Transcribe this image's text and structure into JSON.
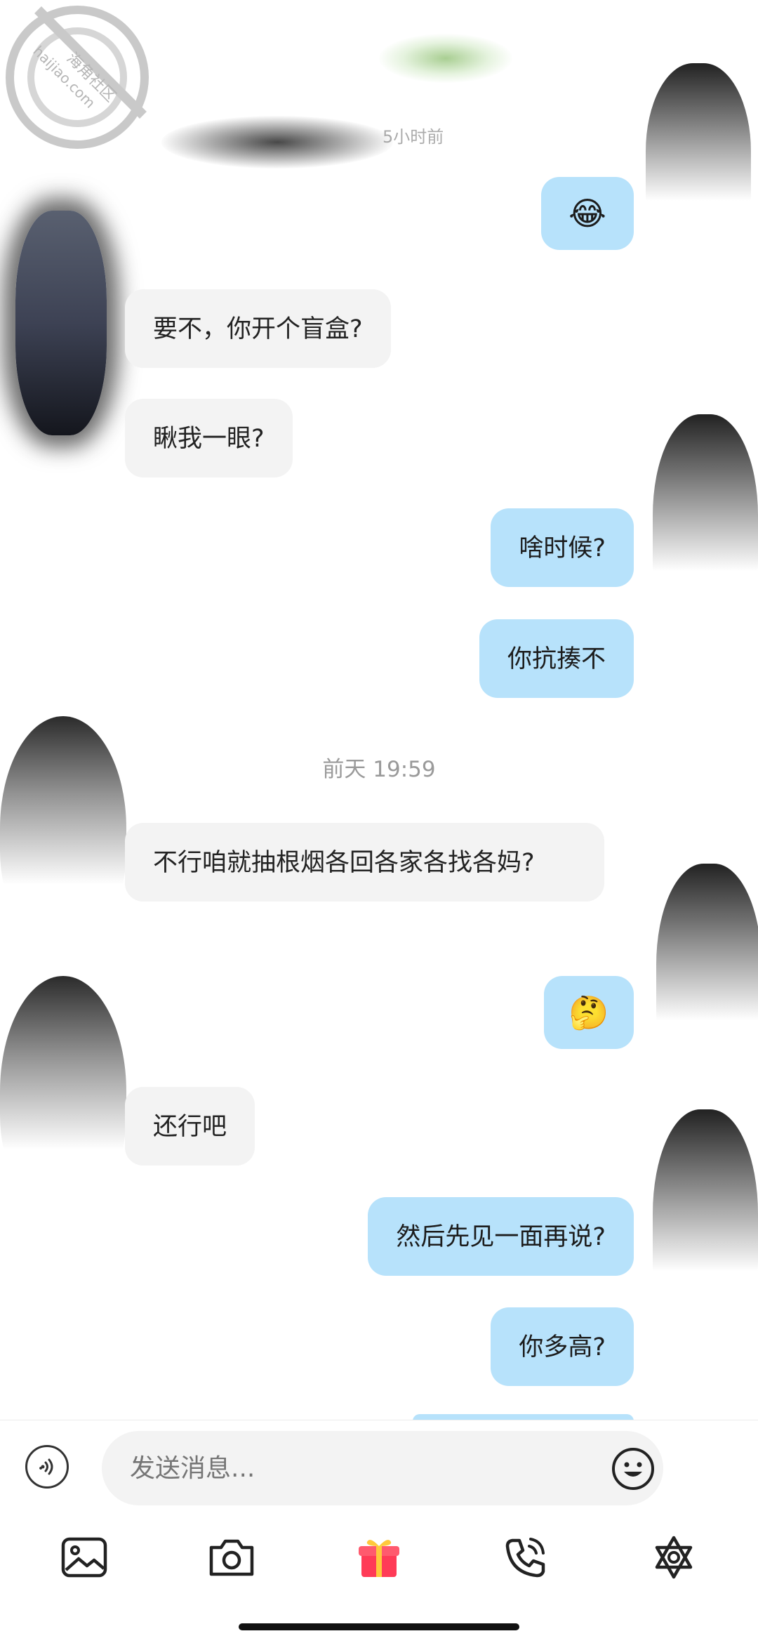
{
  "watermark": {
    "brand": "海角社区",
    "domain": "haijiao.com"
  },
  "top_preview_text": "5小时前",
  "messages": [
    {
      "direction": "out",
      "type": "emoji",
      "content": "😂",
      "icon": "face-with-tears-of-joy-emoji"
    },
    {
      "direction": "in",
      "type": "text",
      "content": "要不，你开个盲盒?"
    },
    {
      "direction": "in",
      "type": "text",
      "content": "瞅我一眼?"
    },
    {
      "direction": "out",
      "type": "text",
      "content": "啥时候?"
    },
    {
      "direction": "out",
      "type": "text",
      "content": "你抗揍不"
    },
    {
      "direction": "in",
      "type": "text",
      "content": "不行咱就抽根烟各回各家各找各妈?"
    },
    {
      "direction": "out",
      "type": "emoji",
      "content": "🤔",
      "icon": "thinking-face-emoji"
    },
    {
      "direction": "in",
      "type": "text",
      "content": "还行吧"
    },
    {
      "direction": "out",
      "type": "text",
      "content": "然后先见一面再说?"
    },
    {
      "direction": "out",
      "type": "text",
      "content": "你多高?"
    }
  ],
  "timestamp": "前天 19:59",
  "composer": {
    "placeholder": "发送消息...",
    "voice_icon": "voice-icon",
    "emoji_icon": "emoji-face-icon"
  },
  "toolbar": [
    {
      "name": "image",
      "icon": "image-icon"
    },
    {
      "name": "camera",
      "icon": "camera-icon"
    },
    {
      "name": "gift",
      "icon": "gift-icon",
      "color": "#ff3b57"
    },
    {
      "name": "call",
      "icon": "phone-call-icon"
    },
    {
      "name": "more",
      "icon": "star-of-david-icon"
    }
  ],
  "colors": {
    "incoming_bubble": "#f3f3f3",
    "outgoing_bubble": "#b7e2fb",
    "timestamp": "#9a9a9a"
  }
}
